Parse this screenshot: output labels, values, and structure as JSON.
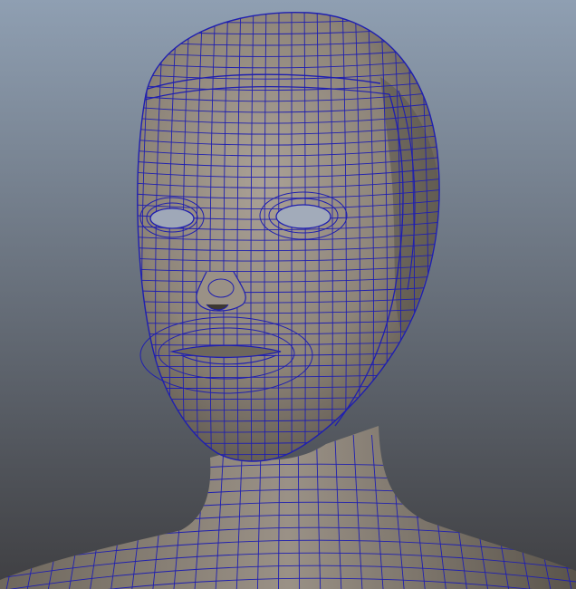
{
  "viewport": {
    "background_top": "#8f9fb2",
    "background_bottom": "#3f3f42",
    "mesh_surface": "#8d8478",
    "mesh_surface_shadow": "#4c463f",
    "wireframe_color": "#1f1fb0"
  },
  "model": {
    "object": "head-mesh",
    "display_mode": "wireframe-on-shaded"
  }
}
